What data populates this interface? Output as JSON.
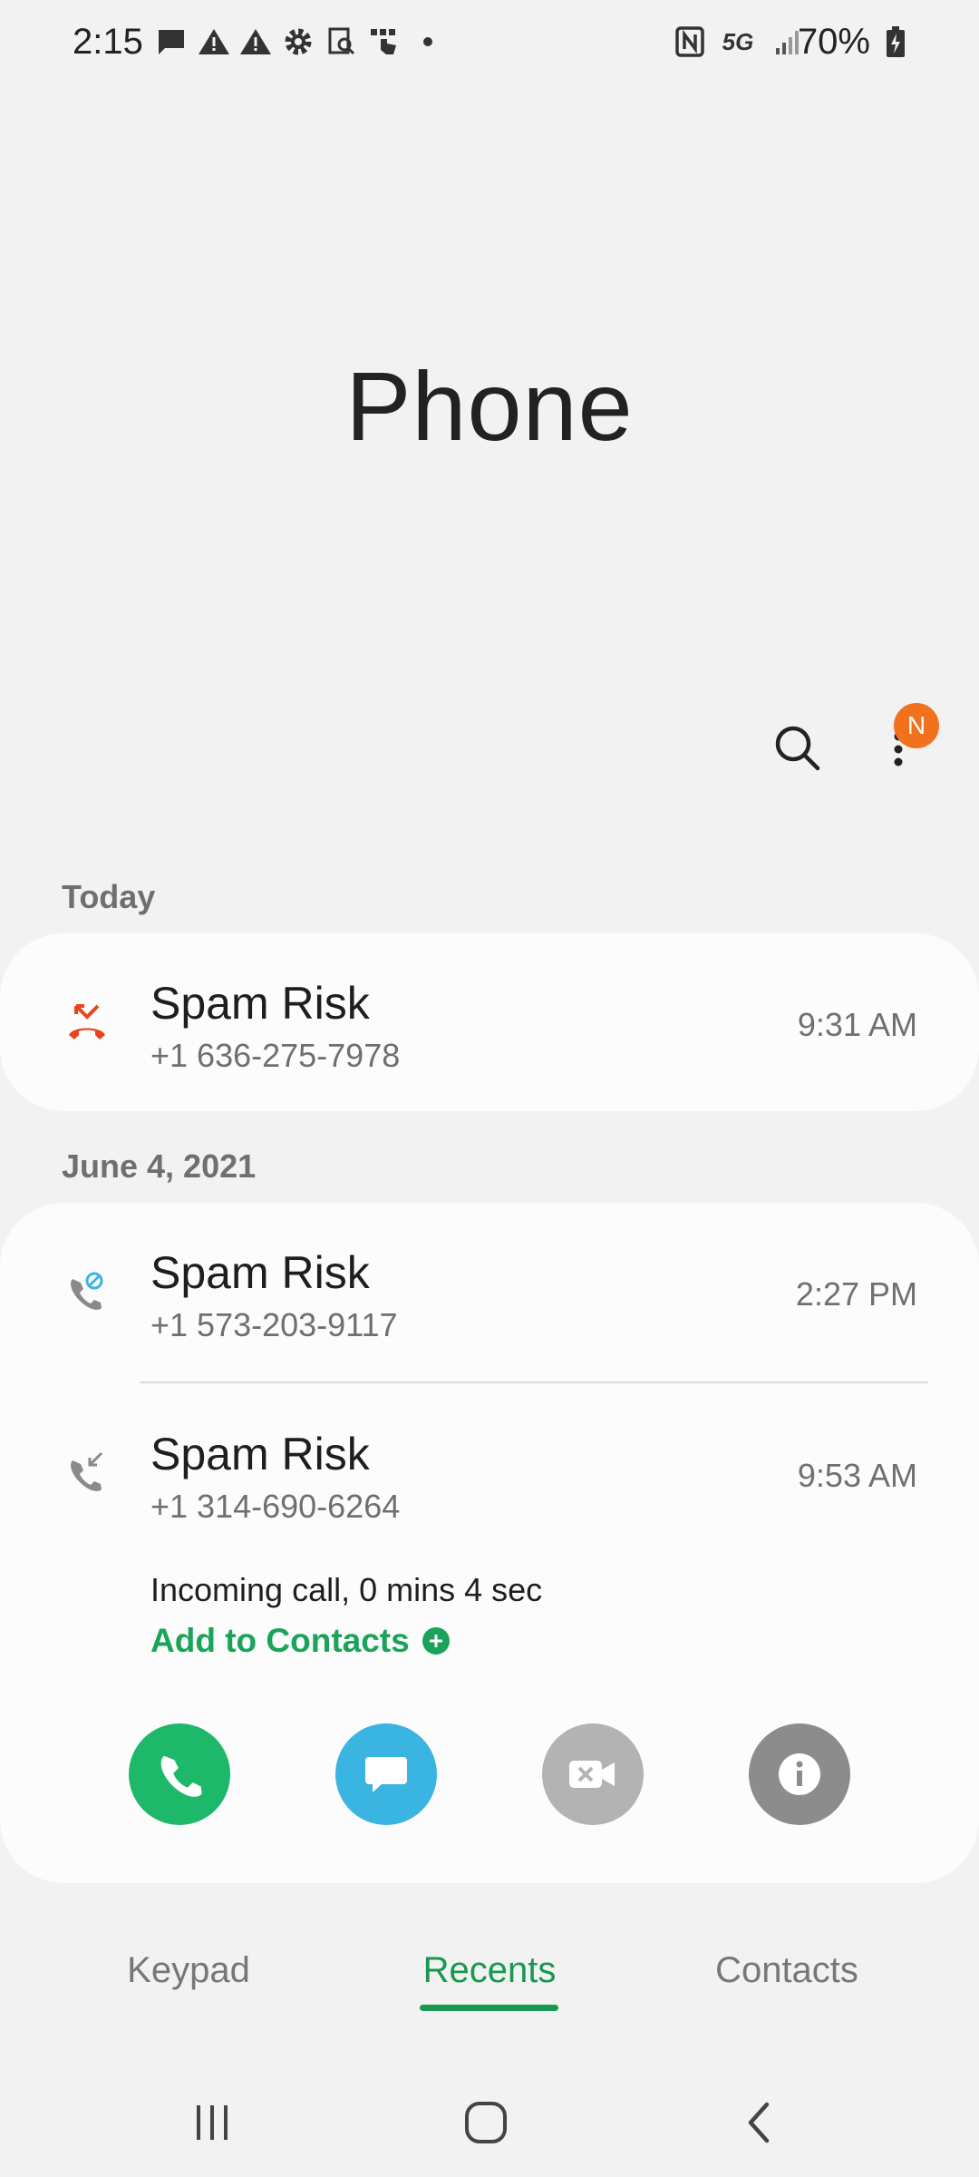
{
  "status_bar": {
    "time": "2:15",
    "network": "5G",
    "battery": "70%"
  },
  "header": {
    "title": "Phone",
    "notification_badge": "N"
  },
  "sections": [
    {
      "label": "Today",
      "calls": [
        {
          "name": "Spam Risk",
          "number": "+1 636-275-7978",
          "time": "9:31 AM",
          "type": "missed-call-icon"
        }
      ]
    },
    {
      "label": "June 4, 2021",
      "calls": [
        {
          "name": "Spam Risk",
          "number": "+1 573-203-9117",
          "time": "2:27 PM",
          "type": "blocked-call-icon"
        },
        {
          "name": "Spam Risk",
          "number": "+1 314-690-6264",
          "time": "9:53 AM",
          "type": "incoming-call-icon",
          "detail": "Incoming call, 0 mins 4 sec",
          "add_label": "Add to Contacts"
        }
      ]
    }
  ],
  "actions": [
    "call",
    "message",
    "video-call",
    "details"
  ],
  "tabs": {
    "keypad": "Keypad",
    "recents": "Recents",
    "contacts": "Contacts"
  },
  "colors": {
    "accent_green": "#18994f",
    "missed_red": "#e8451f",
    "message_blue": "#3ab4e0",
    "badge_orange": "#f2711c"
  }
}
